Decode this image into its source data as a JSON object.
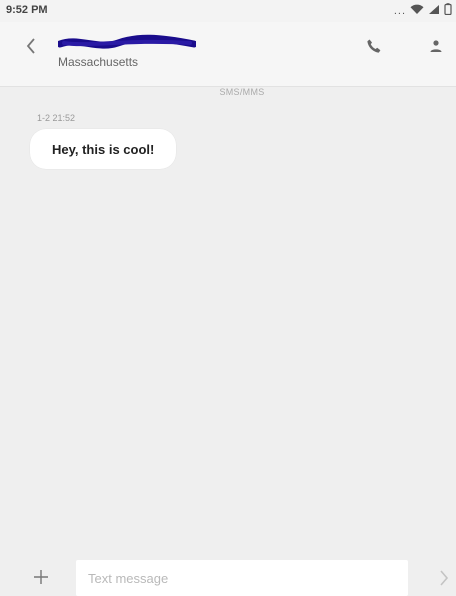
{
  "status_bar": {
    "time": "9:52 PM",
    "overflow_dots": "...",
    "icons": [
      "wifi-icon",
      "signal-icon",
      "battery-icon"
    ]
  },
  "header": {
    "back_icon": "chevron-left-icon",
    "contact_redacted": true,
    "contact_location": "Massachusetts",
    "call_icon": "phone-icon",
    "contact_icon": "person-icon",
    "redaction_color": "#1a0c8c"
  },
  "thread": {
    "label": "SMS/MMS",
    "messages": [
      {
        "timestamp": "1-2 21:52",
        "text": "Hey, this is cool!"
      }
    ]
  },
  "composer": {
    "add_icon": "plus-icon",
    "placeholder": "Text message",
    "value": "",
    "send_icon": "send-chevron-icon"
  },
  "colors": {
    "background": "#efefef",
    "header_bg": "#f6f6f6",
    "bubble_bg": "#ffffff",
    "caret": "#3b6fd8"
  }
}
